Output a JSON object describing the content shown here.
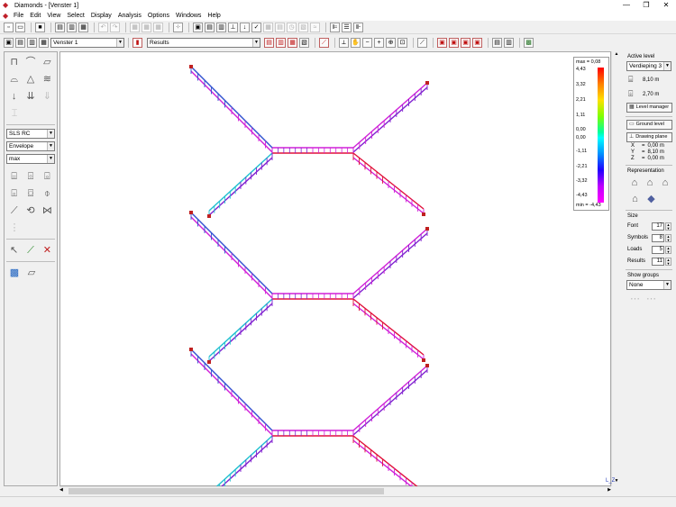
{
  "window": {
    "title": "Diamonds - [Venster 1]",
    "minimize": "—",
    "maximize": "❐",
    "close": "✕"
  },
  "menu": [
    "File",
    "Edit",
    "View",
    "Select",
    "Display",
    "Analysis",
    "Options",
    "Windows",
    "Help"
  ],
  "toolbar2": {
    "window_combo": "Venster 1",
    "results_combo": "Results"
  },
  "left_panel": {
    "combo_limit_state": "SLS RC",
    "combo_envelope": "Envelope",
    "combo_max": "max"
  },
  "legend": {
    "max_label": "max = 0,08",
    "min_label": "min = -4,43",
    "ticks": [
      "4,43",
      "3,32",
      "2,21",
      "1,11",
      "0,00",
      "0,00",
      "-1,11",
      "-2,21",
      "-3,32",
      "-4,43"
    ]
  },
  "right_panel": {
    "active_level_label": "Active level",
    "active_level_value": "Verdieping 3",
    "level_height_1": "8,10 m",
    "level_height_2": "2,70 m",
    "level_manager": "Level manager",
    "ground_level": "Ground level",
    "drawing_plane": "Drawing plane",
    "coords": [
      {
        "k": "X",
        "v": "0,00 m"
      },
      {
        "k": "Y",
        "v": "8,10 m"
      },
      {
        "k": "Z",
        "v": "0,00 m"
      }
    ],
    "representation_label": "Representation",
    "size_label": "Size",
    "sizes": [
      {
        "k": "Font",
        "v": "17"
      },
      {
        "k": "Symbols",
        "v": "8"
      },
      {
        "k": "Loads",
        "v": "5"
      },
      {
        "k": "Results",
        "v": "11"
      }
    ],
    "show_groups_label": "Show groups",
    "show_groups_value": "None"
  },
  "axis_indicator": "L_Z",
  "colors": {
    "magenta": "#d020d8",
    "blue": "#3050d0",
    "red": "#e0103a",
    "cyan": "#20c0d0",
    "purple": "#8020d0"
  }
}
